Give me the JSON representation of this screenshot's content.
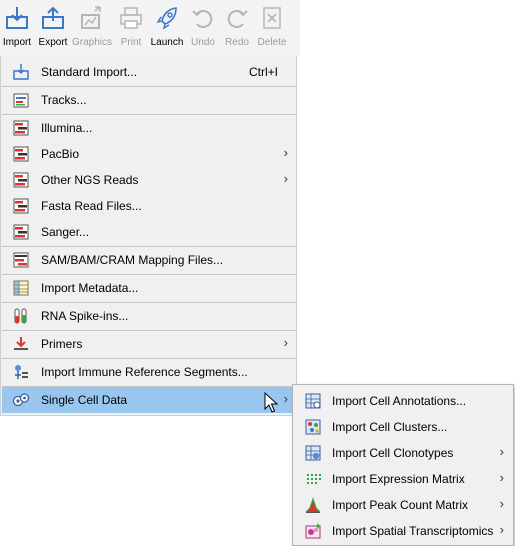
{
  "toolbar": {
    "import": "Import",
    "export": "Export",
    "graphics": "Graphics",
    "print": "Print",
    "launch": "Launch",
    "undo": "Undo",
    "redo": "Redo",
    "delete": "Delete"
  },
  "menu": {
    "standard_import": "Standard Import...",
    "standard_import_shortcut": "Ctrl+I",
    "tracks": "Tracks...",
    "illumina": "Illumina...",
    "pacbio": "PacBio",
    "other_ngs": "Other NGS Reads",
    "fasta": "Fasta Read Files...",
    "sanger": "Sanger...",
    "sam_bam": "SAM/BAM/CRAM Mapping Files...",
    "metadata": "Import Metadata...",
    "rna_spike": "RNA Spike-ins...",
    "primers": "Primers",
    "immune": "Import Immune Reference Segments...",
    "single_cell": "Single Cell Data"
  },
  "submenu": {
    "cell_annotations": "Import Cell Annotations...",
    "cell_clusters": "Import Cell Clusters...",
    "cell_clonotypes": "Import Cell Clonotypes",
    "expression_matrix": "Import Expression Matrix",
    "peak_count": "Import Peak Count Matrix",
    "spatial": "Import Spatial Transcriptomics"
  },
  "glyphs": {
    "submenu_arrow": "›"
  },
  "colors": {
    "highlight": "#99c6ee",
    "menu_bg": "#f0f0f0",
    "disabled_text": "#9b9b9b"
  }
}
